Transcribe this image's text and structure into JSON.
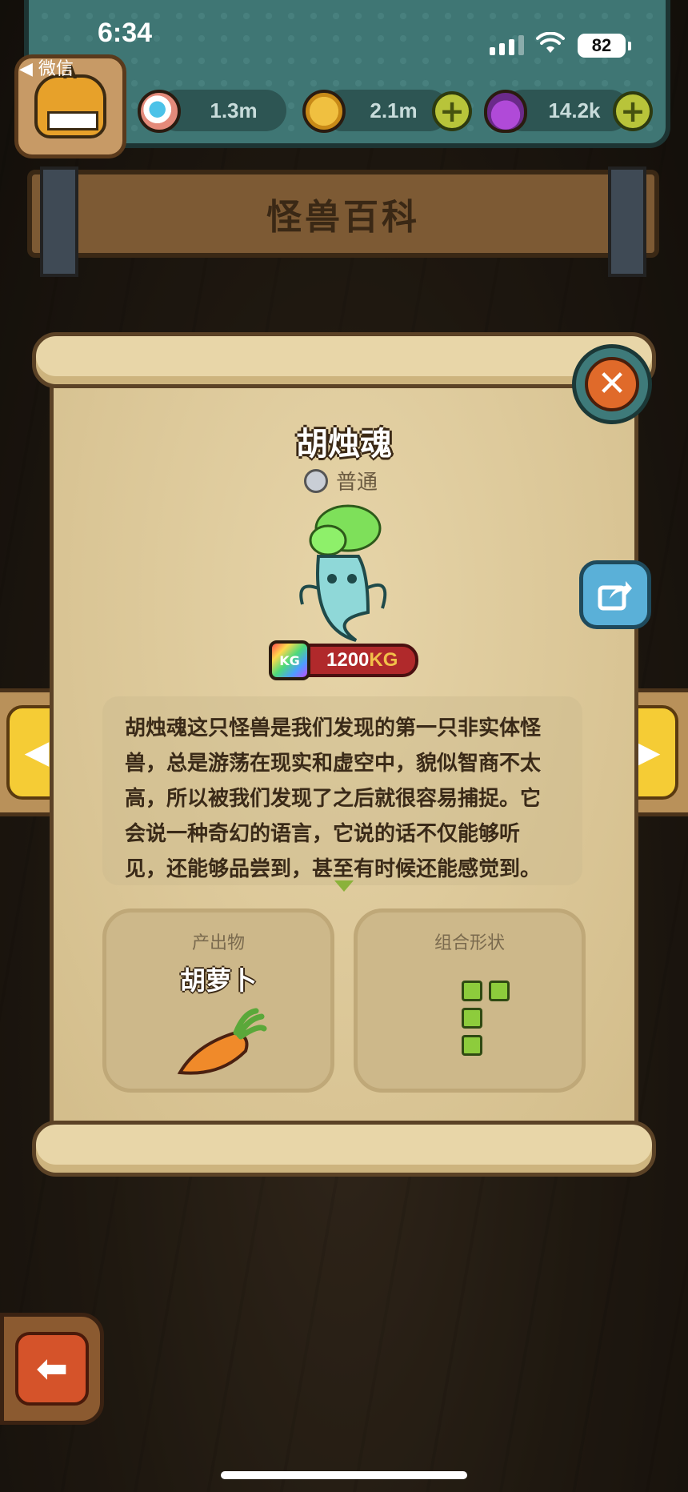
{
  "status_bar": {
    "time": "6:34",
    "back_app": "◀ 微信",
    "battery": "82"
  },
  "hud": {
    "eyes_value": "1.3m",
    "coins_value": "2.1m",
    "potion_value": "14.2k",
    "plus_symbol": "+"
  },
  "banner": {
    "title": "怪兽百科"
  },
  "monster": {
    "name": "胡烛魂",
    "rarity": "普通",
    "weight_number": "1200",
    "weight_unit": "KG",
    "weight_icon_text": "KG",
    "description": "胡烛魂这只怪兽是我们发现的第一只非实体怪兽，总是游荡在现实和虚空中，貌似智商不太高，所以被我们发现了之后就很容易捕捉。它会说一种奇幻的语言，它说的话不仅能够听见，还能够品尝到，甚至有时候还能感觉到。比如它对你说一个什么东西很甜，然后你嘴里"
  },
  "product_panel": {
    "title": "产出物",
    "item_name": "胡萝卜"
  },
  "shape_panel": {
    "title": "组合形状"
  },
  "icons": {
    "close": "close-icon",
    "share": "share-icon",
    "prev": "chevron-left-icon",
    "next": "chevron-right-icon",
    "back": "arrow-left-icon"
  },
  "colors": {
    "hud_teal": "#3f7674",
    "parchment": "#dcc89a",
    "accent_yellow": "#f5cc35",
    "close_orange": "#e06a2a",
    "shape_green": "#8dcc3c"
  }
}
